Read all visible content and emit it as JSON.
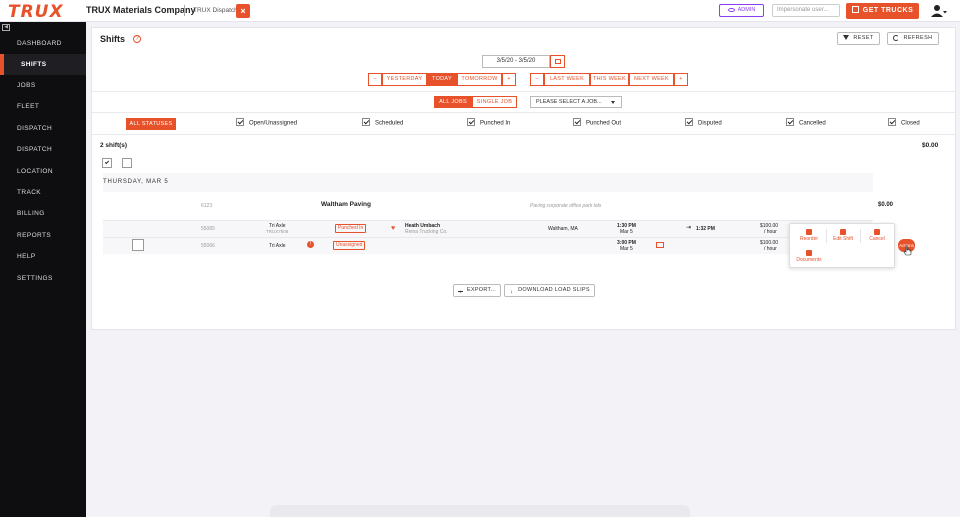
{
  "header": {
    "logo": "TRUX",
    "company": "TRUX Materials Company",
    "app": "TRUX Dispatch",
    "close": "×",
    "admin_label": "ADMIN",
    "impersonate_placeholder": "Impersonate user...",
    "get_trucks_label": "GET TRUCKS"
  },
  "sidebar": {
    "items": [
      {
        "label": "DASHBOARD"
      },
      {
        "label": "SHIFTS"
      },
      {
        "label": "JOBS"
      },
      {
        "label": "FLEET"
      },
      {
        "label": "DISPATCH"
      },
      {
        "label": "DISPATCH"
      },
      {
        "label": "LOCATION"
      },
      {
        "label": "TRACK"
      },
      {
        "label": "BILLING"
      },
      {
        "label": "REPORTS"
      },
      {
        "label": "HELP"
      },
      {
        "label": "SETTINGS"
      }
    ],
    "active": "SHIFTS"
  },
  "page": {
    "title": "Shifts",
    "help": "?",
    "reset_label": "RESET",
    "refresh_label": "REFRESH",
    "date_range": "3/5/20 - 3/5/20",
    "day_nav": {
      "minus": "−",
      "yesterday": "YESTERDAY",
      "today": "TODAY",
      "tomorrow": "TOMORROW",
      "plus": "+"
    },
    "week_nav": {
      "minus": "−",
      "last_week": "LAST WEEK",
      "this_week": "THIS WEEK",
      "next_week": "NEXT WEEK",
      "plus": "+"
    },
    "job_scope": {
      "all_jobs": "ALL JOBS",
      "single_job": "SINGLE JOB"
    },
    "job_select": "PLEASE SELECT A JOB...",
    "statuses": {
      "all": "ALL STATUSES",
      "items": [
        "Open/Unassigned",
        "Scheduled",
        "Punched In",
        "Punched Out",
        "Disputed",
        "Cancelled",
        "Closed"
      ]
    },
    "shift_count": "2 shift(s)",
    "total": "$0.00",
    "date_header": "THURSDAY, MAR 5"
  },
  "job": {
    "id": "6123",
    "customer": "Waltham Paving",
    "description": "Paving corporate office park lots",
    "amount": "$0.00"
  },
  "shifts": [
    {
      "id": "55065",
      "truck_type": "Tri Axle",
      "truck_id": "TRUX7808",
      "status": "Punched In",
      "driver": "Heath Umbach",
      "company": "Reina Trucking Co.",
      "location": "Waltham, MA",
      "start_time": "1:30 PM",
      "start_date": "Mar 5",
      "punch_time": "1:32 PM",
      "rate": "$100.00",
      "rate_unit": "/ hour"
    },
    {
      "id": "55066",
      "truck_type": "Tri Axle",
      "status": "Unassigned",
      "start_time": "3:00 PM",
      "start_date": "Mar 5",
      "rate": "$100.00",
      "rate_unit": "/ hour"
    }
  ],
  "popover": {
    "reorder": "Reorder",
    "edit_shift": "Edit Shift",
    "cancel": "Cancel",
    "documents": "Documents"
  },
  "actions_button": "Actions",
  "footer": {
    "export_label": "EXPORT...",
    "download_label": "DOWNLOAD LOAD SLIPS"
  },
  "colors": {
    "accent": "#e8522b",
    "admin": "#8a3ff0",
    "sidebar": "#0e0e10"
  }
}
